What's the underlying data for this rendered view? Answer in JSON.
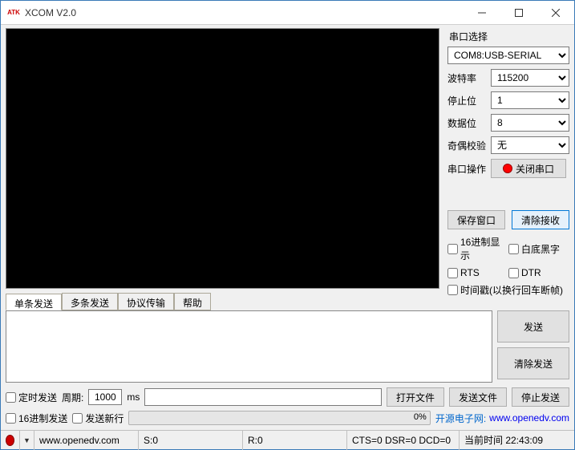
{
  "window": {
    "title": "XCOM V2.0",
    "logo_text": "ATK"
  },
  "port": {
    "section_label": "串口选择",
    "selected": "COM8:USB-SERIAL",
    "baud_label": "波特率",
    "baud_value": "115200",
    "stop_label": "停止位",
    "stop_value": "1",
    "data_label": "数据位",
    "data_value": "8",
    "parity_label": "奇偶校验",
    "parity_value": "无",
    "op_label": "串口操作",
    "op_button": "关闭串口"
  },
  "rx": {
    "save_window": "保存窗口",
    "clear_rx": "清除接收",
    "hex_display": "16进制显示",
    "white_bg": "白底黑字",
    "rts": "RTS",
    "dtr": "DTR",
    "timestamp": "时间戳(以换行回车断帧)"
  },
  "tabs": {
    "single": "单条发送",
    "multi": "多条发送",
    "protocol": "协议传输",
    "help": "帮助"
  },
  "tx": {
    "send": "发送",
    "clear_tx": "清除发送",
    "timed_send": "定时发送",
    "period_label": "周期:",
    "period_value": "1000",
    "period_unit": "ms",
    "open_file": "打开文件",
    "send_file": "发送文件",
    "stop_send": "停止发送",
    "hex_send": "16进制发送",
    "send_newline": "发送新行",
    "progress_pct": "0%",
    "link_label": "开源电子网:",
    "link_url": "www.openedv.com"
  },
  "status": {
    "dropdown_arrow": "▼",
    "url": "www.openedv.com",
    "tx_count": "S:0",
    "rx_count": "R:0",
    "lines": "CTS=0 DSR=0 DCD=0",
    "time_label": "当前时间 22:43:09"
  }
}
